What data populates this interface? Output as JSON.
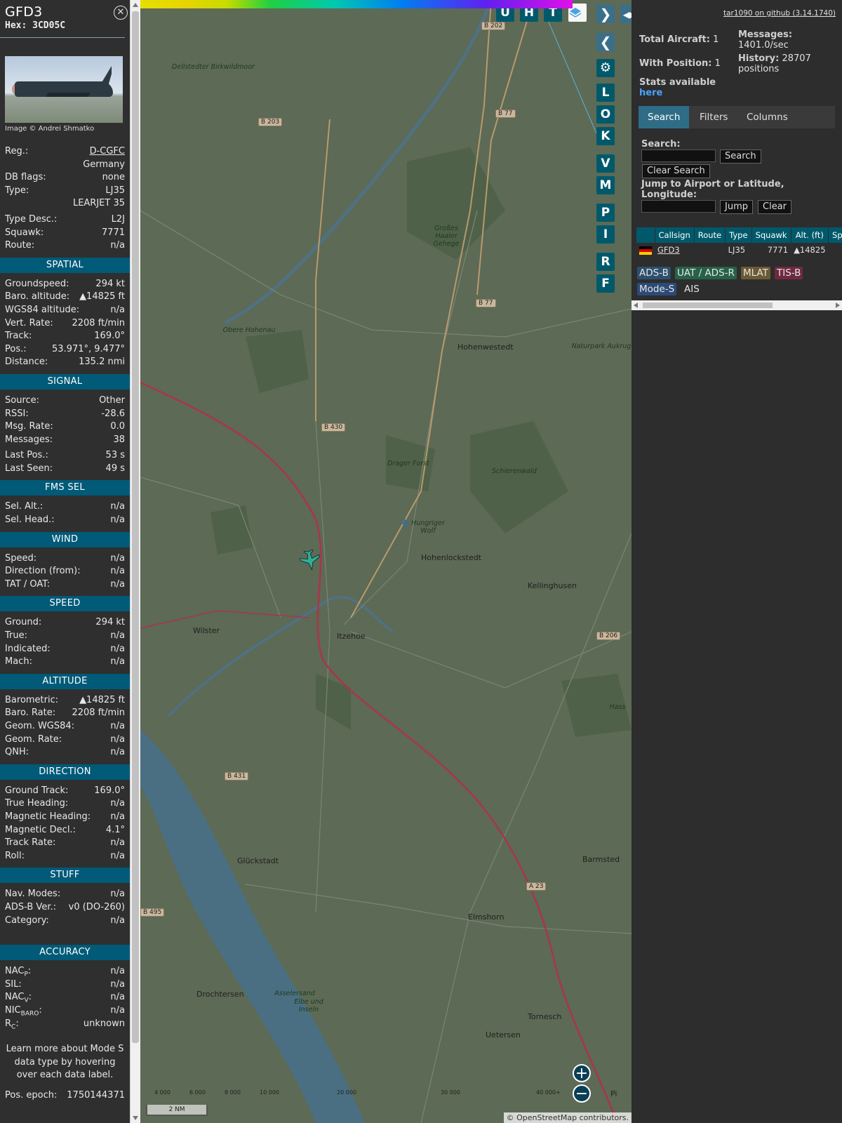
{
  "aircraft": {
    "callsign": "GFD3",
    "hex": "Hex: 3CD05C",
    "image_credit": "Image © Andrei Shmatko"
  },
  "info": {
    "reg_label": "Reg.:",
    "reg": "D-CGFC",
    "country": "Germany",
    "dbflags_label": "DB flags:",
    "dbflags": "none",
    "type_label": "Type:",
    "type": "LJ35",
    "type_name": "LEARJET 35",
    "typedesc_label": "Type Desc.:",
    "typedesc": "L2J",
    "squawk_label": "Squawk:",
    "squawk": "7771",
    "route_label": "Route:",
    "route": "n/a"
  },
  "spatial": {
    "title": "SPATIAL",
    "rows": [
      {
        "k": "Groundspeed:",
        "v": "294 kt"
      },
      {
        "k": "Baro. altitude:",
        "v": "▲14825 ft"
      },
      {
        "k": "WGS84 altitude:",
        "v": "n/a"
      },
      {
        "k": "Vert. Rate:",
        "v": "2208 ft/min"
      },
      {
        "k": "Track:",
        "v": "169.0°"
      },
      {
        "k": "Pos.:",
        "v": "53.971°, 9.477°"
      },
      {
        "k": "Distance:",
        "v": "135.2 nmi"
      }
    ]
  },
  "signal": {
    "title": "SIGNAL",
    "rows": [
      {
        "k": "Source:",
        "v": "Other"
      },
      {
        "k": "RSSI:",
        "v": "-28.6"
      },
      {
        "k": "Msg. Rate:",
        "v": "0.0"
      },
      {
        "k": "Messages:",
        "v": "38"
      }
    ],
    "rows2": [
      {
        "k": "Last Pos.:",
        "v": "53 s"
      },
      {
        "k": "Last Seen:",
        "v": "49 s"
      }
    ]
  },
  "fms": {
    "title": "FMS SEL",
    "rows": [
      {
        "k": "Sel. Alt.:",
        "v": "n/a"
      },
      {
        "k": "Sel. Head.:",
        "v": "n/a"
      }
    ]
  },
  "wind": {
    "title": "WIND",
    "rows": [
      {
        "k": "Speed:",
        "v": "n/a"
      },
      {
        "k": "Direction (from):",
        "v": "n/a"
      },
      {
        "k": "TAT / OAT:",
        "v": "n/a"
      }
    ]
  },
  "speed": {
    "title": "SPEED",
    "rows": [
      {
        "k": "Ground:",
        "v": "294 kt"
      },
      {
        "k": "True:",
        "v": "n/a"
      },
      {
        "k": "Indicated:",
        "v": "n/a"
      },
      {
        "k": "Mach:",
        "v": "n/a"
      }
    ]
  },
  "altitude": {
    "title": "ALTITUDE",
    "rows": [
      {
        "k": "Barometric:",
        "v": "▲14825 ft"
      },
      {
        "k": "Baro. Rate:",
        "v": "2208 ft/min"
      },
      {
        "k": "Geom. WGS84:",
        "v": "n/a"
      },
      {
        "k": "Geom. Rate:",
        "v": "n/a"
      },
      {
        "k": "QNH:",
        "v": "n/a"
      }
    ]
  },
  "direction": {
    "title": "DIRECTION",
    "rows": [
      {
        "k": "Ground Track:",
        "v": "169.0°"
      },
      {
        "k": "True Heading:",
        "v": "n/a"
      },
      {
        "k": "Magnetic Heading:",
        "v": "n/a"
      },
      {
        "k": "Magnetic Decl.:",
        "v": "4.1°"
      },
      {
        "k": "Track Rate:",
        "v": "n/a"
      },
      {
        "k": "Roll:",
        "v": "n/a"
      }
    ]
  },
  "stuff": {
    "title": "STUFF",
    "rows": [
      {
        "k": "Nav. Modes:",
        "v": "n/a"
      },
      {
        "k": "ADS-B Ver.:",
        "v": "v0 (DO-260)"
      },
      {
        "k": "Category:",
        "v": "n/a"
      }
    ]
  },
  "accuracy": {
    "title": "ACCURACY",
    "rows": [
      {
        "k": "NAC",
        "sub": "P",
        "v": "n/a"
      },
      {
        "k": "SIL:",
        "sub": "",
        "v": "n/a"
      },
      {
        "k": "NAC",
        "sub": "V",
        "v": "n/a"
      },
      {
        "k": "NIC",
        "sub": "BARO",
        "v": "n/a"
      },
      {
        "k": "R",
        "sub": "C",
        "v": "unknown"
      }
    ],
    "note": "Learn more about Mode S data type by hovering over each data label.",
    "epoch_label": "Pos. epoch:",
    "epoch": "1750144371"
  },
  "map": {
    "places": [
      "Hohenwestedt",
      "Hohenlockstedt",
      "Kellinghusen",
      "Wilster",
      "Itzehoe",
      "Glückstadt",
      "Elmshorn",
      "Barmsted",
      "Drochtersen",
      "Tornesch",
      "Uetersen",
      "Pi"
    ],
    "nature": [
      "Dellstedter Birkwildmoor",
      "Obere Hohenau",
      "Großes Haaler Gehege",
      "Drager Forst",
      "Schierenwald",
      "Hungriger Wolf",
      "Naturpark Aukrug",
      "Asselersand",
      "Elbe und Inseln",
      "Hass"
    ],
    "roads": [
      "B 202",
      "B 203",
      "B 77",
      "B 77",
      "B 430",
      "B 206",
      "B 431",
      "A 23",
      "B 495"
    ],
    "toolbar": [
      "U",
      "H",
      "T"
    ],
    "side_buttons": [
      "L",
      "O",
      "K",
      "V",
      "M",
      "P",
      "I",
      "R",
      "F"
    ],
    "alt_ticks": [
      "4 000",
      "6 000",
      "8 000",
      "10 000",
      "20 000",
      "30 000",
      "40 000+"
    ],
    "scale": "2 NM",
    "attribution": "© OpenStreetMap contributors."
  },
  "right": {
    "github": "tar1090 on github (3.14.1740)",
    "total_aircraft": "Total Aircraft:",
    "total_aircraft_val": "1",
    "with_position": "With Position:",
    "with_position_val": "1",
    "messages_label": "Messages:",
    "messages_val": "1401.0/sec",
    "history_label": "History:",
    "history_val": "28707",
    "history_unit": "positions",
    "stats_text": "Stats available",
    "stats_link": "here",
    "tabs": [
      "Search",
      "Filters",
      "Columns"
    ],
    "search_label": "Search:",
    "search_btn": "Search",
    "clear_search_btn": "Clear Search",
    "jump_label": "Jump to Airport or Latitude, Longitude:",
    "jump_btn": "Jump",
    "clear_btn": "Clear",
    "columns": [
      "",
      "Callsign",
      "Route",
      "Type",
      "Squawk",
      "Alt. (ft)",
      "Spd"
    ],
    "row": {
      "callsign": "GFD3",
      "route": "",
      "type": "LJ35",
      "squawk": "7771",
      "alt": "▲14825"
    },
    "legend": [
      {
        "label": "ADS-B",
        "color": "#2c4f6e"
      },
      {
        "label": "UAT / ADS-R",
        "color": "#27614a"
      },
      {
        "label": "MLAT",
        "color": "#6c5a33"
      },
      {
        "label": "TIS-B",
        "color": "#6e2a3f"
      },
      {
        "label": "Mode-S",
        "color": "#2c4a77"
      },
      {
        "label": "AIS",
        "color": "#2d2d2d"
      }
    ]
  }
}
